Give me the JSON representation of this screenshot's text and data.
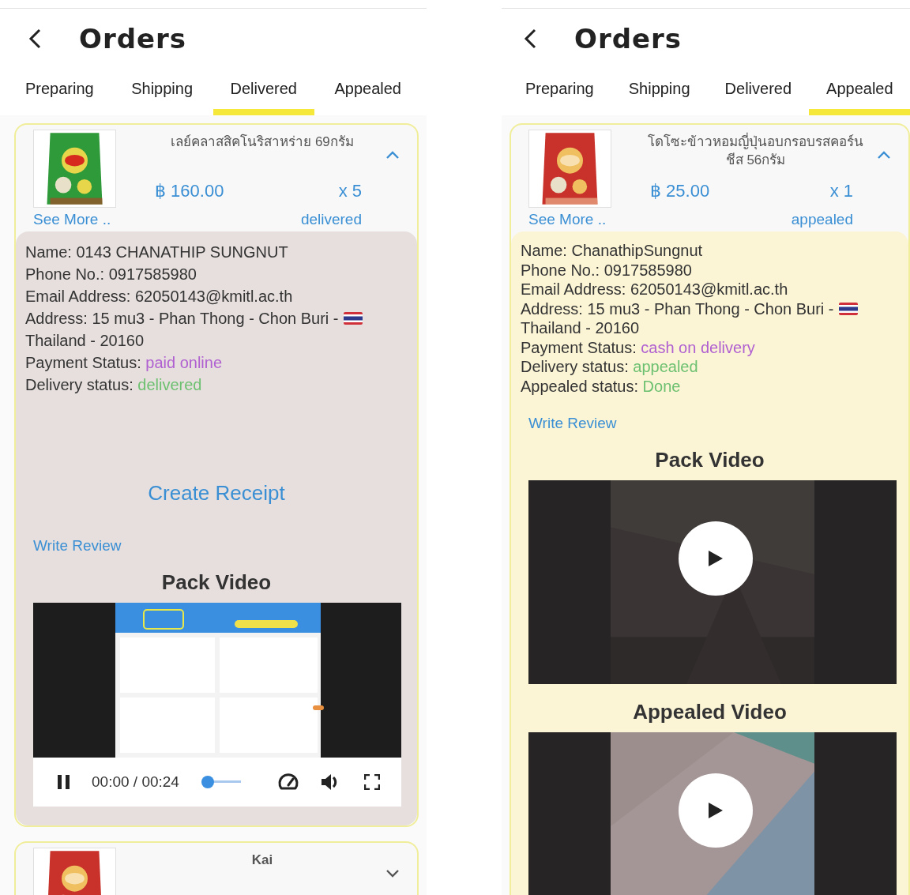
{
  "screens": [
    {
      "title": "Orders",
      "tabs": [
        {
          "label": "Preparing",
          "selected": false
        },
        {
          "label": "Shipping",
          "selected": false
        },
        {
          "label": "Delivered",
          "selected": true
        },
        {
          "label": "Appealed",
          "selected": false
        }
      ],
      "orders": [
        {
          "name": "เลย์คลาสสิคโนริสาหร่าย 69กรัม",
          "price": "฿ 160.00",
          "quantity": "x 5",
          "see_more": "See More ..",
          "status": "delivered",
          "expanded": true,
          "color": "#e6dfdd",
          "details": [
            {
              "kind": "text",
              "label": "Name:",
              "value": "0143 CHANATHIP SUNGNUT"
            },
            {
              "kind": "text",
              "label": "Phone No.:",
              "value": "0917585980"
            },
            {
              "kind": "text",
              "label": "Email Address:",
              "value": "62050143@kmitl.ac.th"
            },
            {
              "kind": "address",
              "label": "Address:",
              "value": "15 mu3 - Phan Thong - Chon Buri -",
              "continuation": "Thailand - 20160"
            },
            {
              "kind": "payment",
              "label": "Payment Status:",
              "value": "paid online"
            },
            {
              "kind": "status",
              "label": "Delivery status:",
              "value": "delivered"
            }
          ],
          "receipt": "Create Receipt",
          "review": "Write Review",
          "videos": [
            {
              "title": "Pack Video",
              "kind": "playing",
              "time": "00:00 / 00:24",
              "level": 0.05
            }
          ]
        },
        {
          "name": "Kai",
          "expanded": false
        }
      ]
    },
    {
      "title": "Orders",
      "tabs": [
        {
          "label": "Preparing",
          "selected": false
        },
        {
          "label": "Shipping",
          "selected": false
        },
        {
          "label": "Delivered",
          "selected": false
        },
        {
          "label": "Appealed",
          "selected": true
        }
      ],
      "orders": [
        {
          "name": "โดโซะข้าวหอมญี่ปุ่นอบกรอบรสคอร์นชีส 56กรัม",
          "price": "฿ 25.00",
          "quantity": "x 1",
          "see_more": "See More ..",
          "status": "appealed",
          "expanded": true,
          "color": "#fbf5d6",
          "details": [
            {
              "kind": "text",
              "label": "Name:",
              "value": "ChanathipSungnut"
            },
            {
              "kind": "text",
              "label": "Phone No.:",
              "value": "0917585980"
            },
            {
              "kind": "text",
              "label": "Email Address:",
              "value": "62050143@kmitl.ac.th"
            },
            {
              "kind": "address",
              "label": "Address:",
              "value": "15 mu3 - Phan Thong - Chon Buri -",
              "continuation": "Thailand - 20160"
            },
            {
              "kind": "payment",
              "label": "Payment Status:",
              "value": "cash on delivery"
            },
            {
              "kind": "status",
              "label": "Delivery status:",
              "value": "appealed"
            },
            {
              "kind": "status",
              "label": "Appealed status:",
              "value": "Done"
            }
          ],
          "review": "Write Review",
          "videos": [
            {
              "title": "Pack Video",
              "kind": "paused"
            },
            {
              "title": "Appealed Video",
              "kind": "paused"
            }
          ]
        }
      ]
    }
  ]
}
